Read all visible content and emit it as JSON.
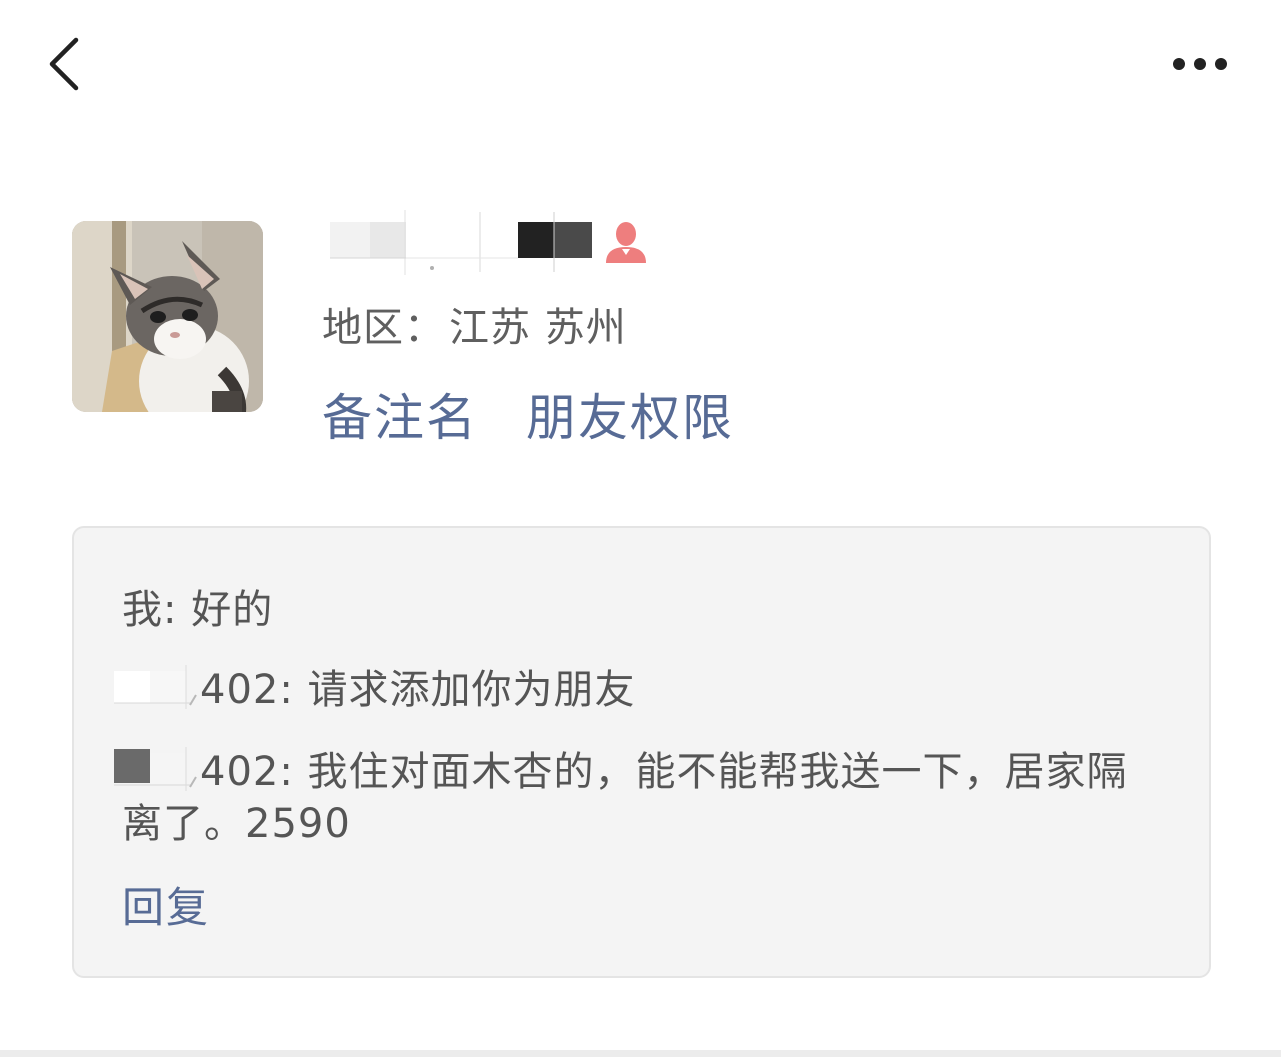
{
  "header": {
    "back_icon": "chevron-left-icon",
    "more_icon": "more-horizontal-icon"
  },
  "profile": {
    "avatar": "cat-photo-avatar",
    "gender_icon": "female-icon",
    "gender_color": "#ee7e7e",
    "region_label": "地区：",
    "region_value": "江苏 苏州",
    "remark_link": "备注名",
    "permission_link": "朋友权限"
  },
  "messages": {
    "items": [
      {
        "text": "我: 好的"
      },
      {
        "sender_suffix": "402",
        "text": ": 请求添加你为朋友"
      },
      {
        "sender_suffix": "402",
        "text": ": 我住对面木杏的，能不能帮我送一下，居家隔离了。2590"
      }
    ],
    "reply_label": "回复"
  },
  "colors": {
    "link": "#576b95",
    "text": "#555555",
    "box_bg": "#f4f4f4"
  }
}
